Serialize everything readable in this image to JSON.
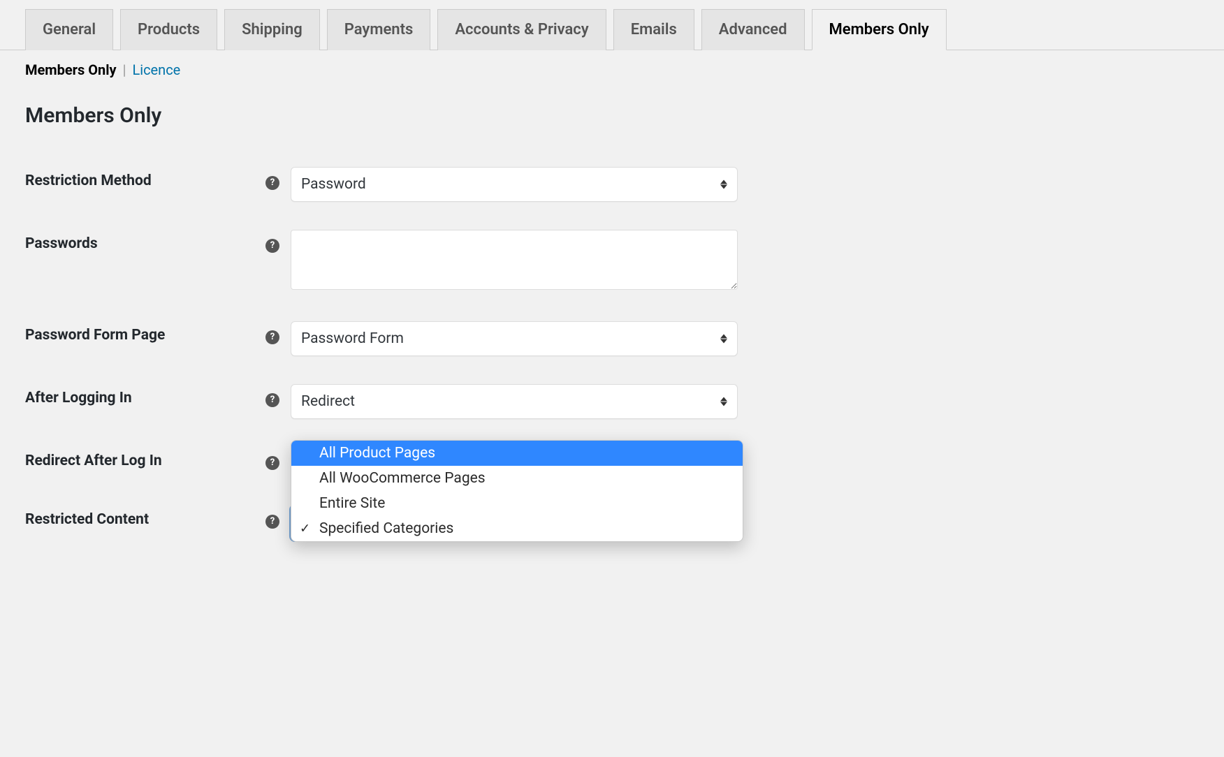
{
  "tabs": {
    "items": [
      {
        "label": "General"
      },
      {
        "label": "Products"
      },
      {
        "label": "Shipping"
      },
      {
        "label": "Payments"
      },
      {
        "label": "Accounts & Privacy"
      },
      {
        "label": "Emails"
      },
      {
        "label": "Advanced"
      },
      {
        "label": "Members Only"
      }
    ],
    "active_index": 7
  },
  "subnav": {
    "current": "Members Only",
    "other": "Licence"
  },
  "section": {
    "title": "Members Only"
  },
  "fields": {
    "restriction_method": {
      "label": "Restriction Method",
      "value": "Password"
    },
    "passwords": {
      "label": "Passwords",
      "value": ""
    },
    "password_form_page": {
      "label": "Password Form Page",
      "value": "Password Form"
    },
    "after_logging_in": {
      "label": "After Logging In",
      "value": "Redirect"
    },
    "redirect_after_login": {
      "label": "Redirect After Log In"
    },
    "restricted_content": {
      "label": "Restricted Content",
      "selected_value": "Specified Categories",
      "open": true,
      "highlighted_index": 0,
      "options": [
        "All Product Pages",
        "All WooCommerce Pages",
        "Entire Site",
        "Specified Categories"
      ]
    }
  },
  "help_glyph": "?"
}
